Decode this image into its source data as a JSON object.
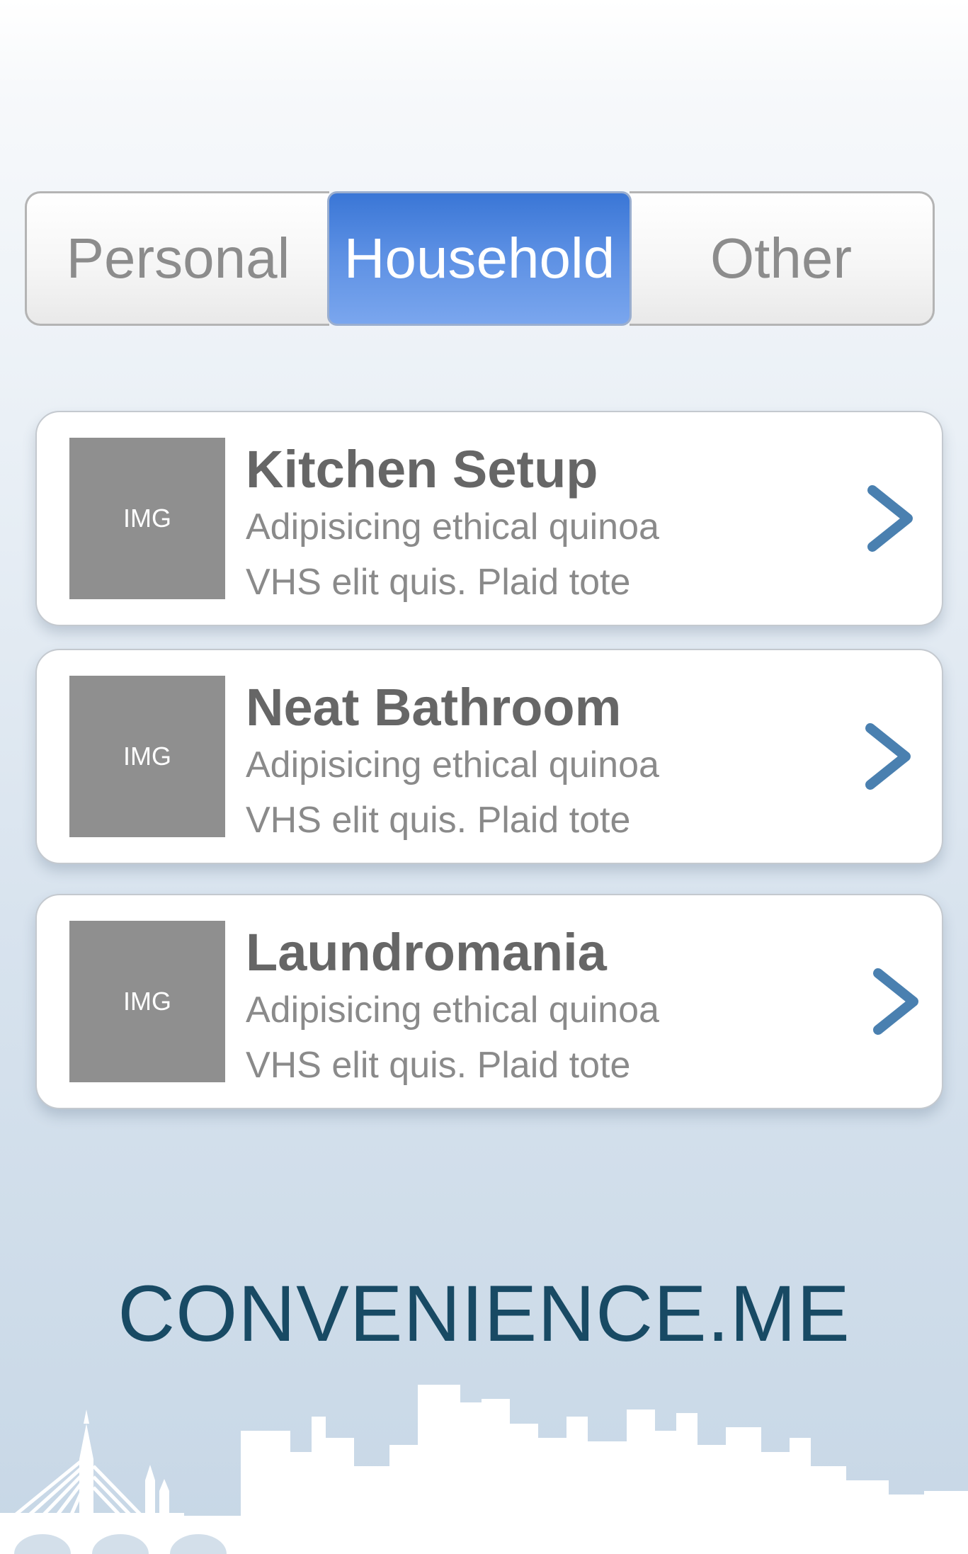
{
  "tabs": {
    "personal": "Personal",
    "household": "Household",
    "other": "Other",
    "selected": "Household"
  },
  "items": [
    {
      "title": "Kitchen Setup",
      "image_label": "IMG",
      "line1": "Adipisicing ethical quinoa",
      "line2": "VHS elit quis. Plaid tote"
    },
    {
      "title": "Neat Bathroom",
      "image_label": "IMG",
      "line1": "Adipisicing ethical quinoa",
      "line2": "VHS elit quis. Plaid tote"
    },
    {
      "title": "Laundromania",
      "image_label": "IMG",
      "line1": "Adipisicing ethical quinoa",
      "line2": "VHS elit quis. Plaid tote"
    }
  ],
  "brand": "CONVENIENCE.ME",
  "colors": {
    "accent_blue": "#4a90e2",
    "chevron_blue": "#4a80b0",
    "brand_teal": "#184a64"
  },
  "icons": {
    "chevron": "chevron-right-icon",
    "skyline": "city-skyline-illustration"
  }
}
